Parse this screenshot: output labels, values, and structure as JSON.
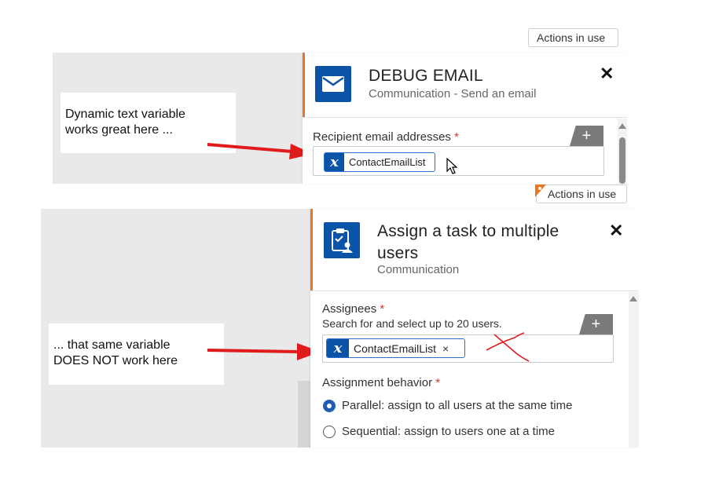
{
  "top_panel": {
    "actions_button_label": "Actions in use",
    "annotation": [
      "Dynamic text variable",
      "works great here ..."
    ],
    "action_title": "DEBUG EMAIL",
    "action_subtitle": "Communication - Send an email",
    "field_label": "Recipient email addresses",
    "required_marker": "*",
    "add_label": "+",
    "variable_chip": {
      "icon": "x",
      "label": "ContactEmailList"
    }
  },
  "bottom_panel": {
    "actions_button_label": "Actions in use",
    "annotation": [
      "... that same variable",
      "DOES NOT work here"
    ],
    "action_title": [
      "Assign a task to multiple",
      "users"
    ],
    "action_subtitle": "Communication",
    "field_label": "Assignees",
    "required_marker": "*",
    "field_hint": "Search for and select up to 20 users.",
    "add_label": "+",
    "variable_chip": {
      "icon": "x",
      "label": "ContactEmailList",
      "remove": "×"
    },
    "behavior_label": "Assignment behavior",
    "behavior_options": [
      {
        "label": "Parallel: assign to all users at the same time",
        "selected": true
      },
      {
        "label": "Sequential: assign to users one at a time",
        "selected": false
      }
    ]
  },
  "colors": {
    "accent_orange": "#e87722",
    "icon_blue": "#0a53a6",
    "arrow_red": "#e01b1b",
    "required_red": "#d0342c"
  }
}
